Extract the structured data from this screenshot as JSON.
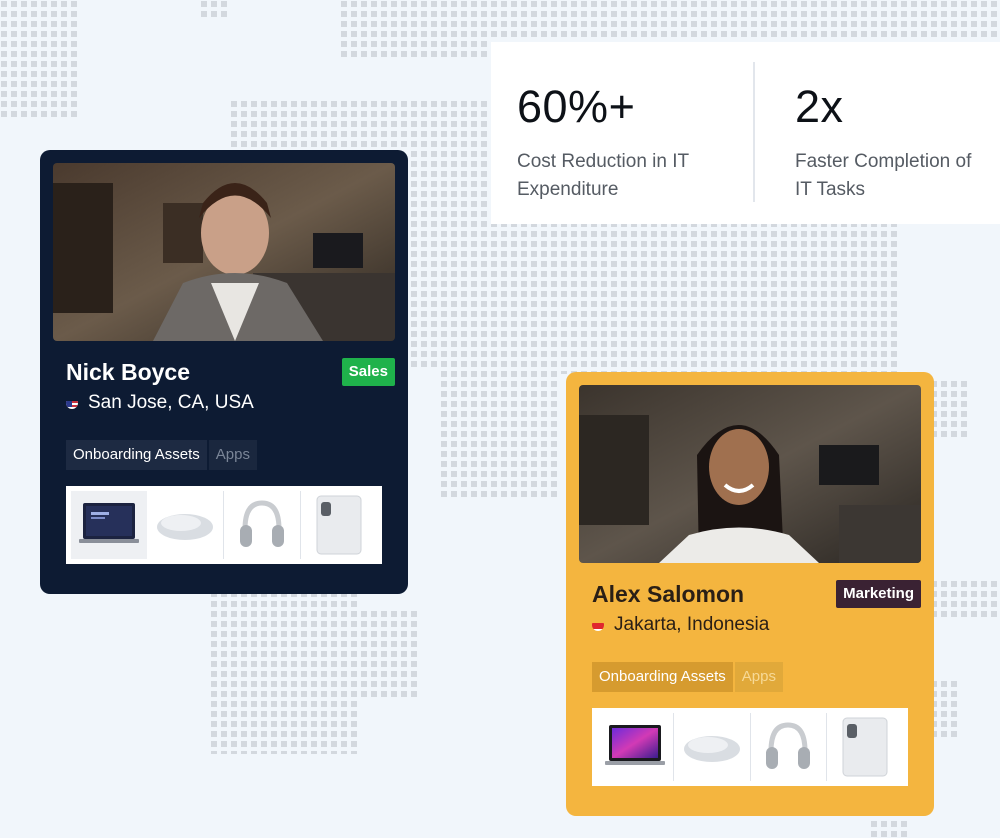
{
  "stats": [
    {
      "value": "60%+",
      "label": "Cost Reduction in IT\nExpenditure"
    },
    {
      "value": "2x",
      "label": "Faster Completion of\nIT Tasks"
    }
  ],
  "cards": [
    {
      "name": "Nick Boyce",
      "badge": "Sales",
      "location": "San Jose, CA, USA",
      "tags": [
        "Onboarding Assets",
        "Apps"
      ],
      "devices": [
        "laptop-icon",
        "mouse-icon",
        "headphones-icon",
        "tablet-icon"
      ],
      "accent": "#0d1b33"
    },
    {
      "name": "Alex Salomon",
      "badge": "Marketing",
      "location": "Jakarta, Indonesia",
      "tags": [
        "Onboarding Assets",
        "Apps"
      ],
      "devices": [
        "laptop-icon",
        "mouse-icon",
        "headphones-icon",
        "tablet-icon"
      ],
      "accent": "#f4b53f"
    }
  ]
}
